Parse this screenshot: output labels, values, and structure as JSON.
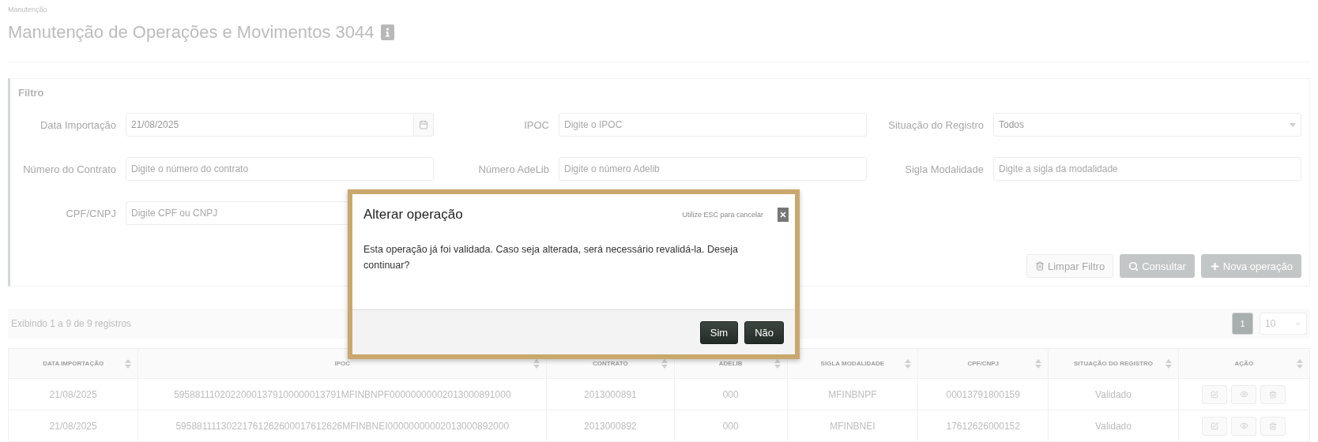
{
  "breadcrumb": "Manutenção",
  "title": "Manutenção de Operações e Movimentos 3044",
  "filter": {
    "title": "Filtro",
    "fields": [
      {
        "label": "Data Importação",
        "kind": "date",
        "value": "21/08/2025"
      },
      {
        "label": "IPOC",
        "kind": "text",
        "placeholder": "Digite o IPOC"
      },
      {
        "label": "Situação do Registro",
        "kind": "select",
        "value": "Todos"
      },
      {
        "label": "Número do Contrato",
        "kind": "text",
        "placeholder": "Digite o número do contrato"
      },
      {
        "label": "Número AdeLib",
        "kind": "text",
        "placeholder": "Digite o número Adelib"
      },
      {
        "label": "Sigla Modalidade",
        "kind": "text",
        "placeholder": "Digite a sigla da modalidade"
      },
      {
        "label": "CPF/CNPJ",
        "kind": "text",
        "placeholder": "Digite CPF ou CNPJ"
      }
    ],
    "buttons": [
      {
        "label": "Limpar Filtro",
        "kind": "clear"
      },
      {
        "label": "Consultar",
        "kind": "search"
      },
      {
        "label": "Nova operação",
        "kind": "create"
      }
    ]
  },
  "summary": "Exibindo 1 a 9 de 9 registros",
  "pagination": {
    "pages": [
      {
        "label": "1",
        "selected": true
      }
    ],
    "page_size": "10"
  },
  "table": {
    "columns": [
      "DATA IMPORTAÇÃO",
      "IPOC",
      "CONTRATO",
      "ADELIB",
      "SIGLA MODALIDADE",
      "CPF/CNPJ",
      "SITUAÇÃO DO REGISTRO",
      "AÇÃO"
    ],
    "rows": [
      {
        "cells": [
          "21/08/2025",
          "59588111020220001379100000013791MFINBNPF00000000002013000891000",
          "2013000891",
          "000",
          "MFINBNPF",
          "00013791800159",
          "Validado"
        ]
      },
      {
        "cells": [
          "21/08/2025",
          "59588111130221761262600017612626MFINBNEI00000000002013000892000",
          "2013000892",
          "000",
          "MFINBNEI",
          "17612626000152",
          "Validado"
        ]
      }
    ]
  },
  "dialog": {
    "title": "Alterar operação",
    "hint": "Utilize ESC para cancelar",
    "message": "Esta operação já foi validada. Caso seja alterada, será necessário revalidá-la. Deseja continuar?",
    "buttons": [
      "Sim",
      "Não"
    ]
  }
}
